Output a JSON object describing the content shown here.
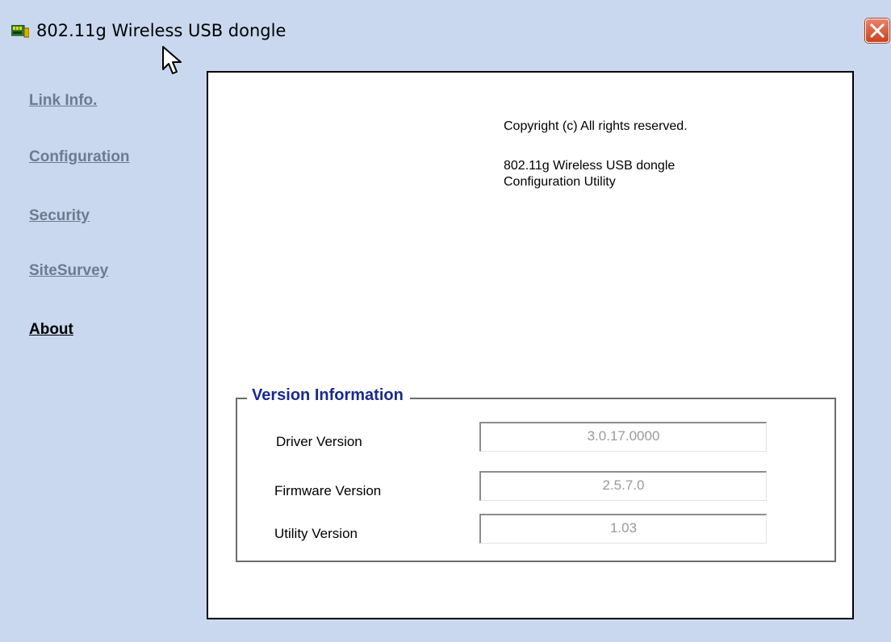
{
  "window": {
    "title": "802.11g Wireless USB dongle",
    "title_icon": "network-card-icon",
    "close_icon": "close-icon"
  },
  "sidebar": {
    "items": [
      {
        "label": "Link Info.",
        "active": false
      },
      {
        "label": "Configuration",
        "active": false
      },
      {
        "label": "Security",
        "active": false
      },
      {
        "label": "SiteSurvey",
        "active": false
      },
      {
        "label": "About",
        "active": true
      }
    ]
  },
  "about": {
    "copyright": "Copyright (c)  All rights reserved.",
    "product_line1": "802.11g Wireless USB dongle",
    "product_line2": "Configuration Utility"
  },
  "version_info": {
    "title": "Version Information",
    "rows": [
      {
        "label": "Driver Version",
        "value": "3.0.17.0000"
      },
      {
        "label": "Firmware Version",
        "value": "2.5.7.0"
      },
      {
        "label": "Utility Version",
        "value": "1.03"
      }
    ]
  },
  "colors": {
    "window_bg": "#c9d8ef",
    "inactive_link": "#6e7a8e",
    "active_link": "#000000",
    "group_title": "#1a2a8c",
    "disabled_text": "#9a9a9a",
    "close_button": "#d45a36"
  }
}
